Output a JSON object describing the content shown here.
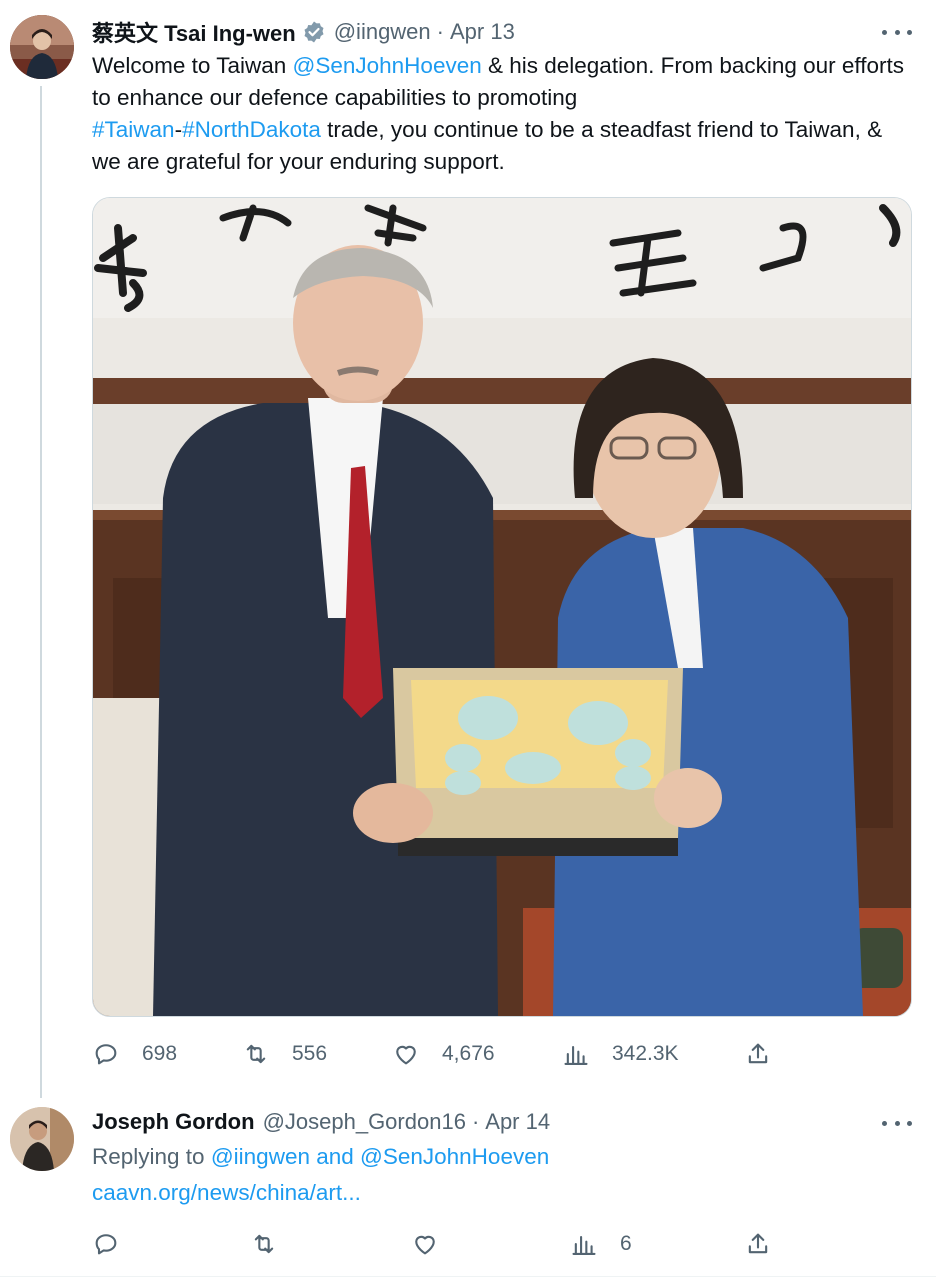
{
  "tweet": {
    "display_name": "蔡英文 Tsai Ing-wen",
    "verified_icon": "verified-badge-icon",
    "handle": "@iingwen",
    "separator": "·",
    "date": "Apr 13",
    "text": {
      "part1": "Welcome to Taiwan ",
      "mention": "@SenJohnHoeven",
      "part2": " & his delegation. From backing our efforts to enhance our defence capabilities to promoting ",
      "hashtag1": "#Taiwan",
      "dash": "-",
      "hashtag2": "#NorthDakota",
      "part3": " trade, you continue to be a steadfast friend to Taiwan, & we are grateful for your enduring support."
    },
    "actions": {
      "replies": "698",
      "retweets": "556",
      "likes": "4,676",
      "views": "342.3K"
    }
  },
  "reply": {
    "display_name": "Joseph Gordon",
    "handle": "@Joseph_Gordon16",
    "separator": "·",
    "date": "Apr 14",
    "replying_prefix": "Replying to ",
    "replying_to": "@iingwen and @SenJohnHoeven",
    "link": "caavn.org/news/china/art...",
    "actions": {
      "views": "6"
    }
  },
  "colors": {
    "accent": "#1d9bf0",
    "muted": "#536471",
    "text": "#0f1419",
    "verified": "#829aab"
  }
}
